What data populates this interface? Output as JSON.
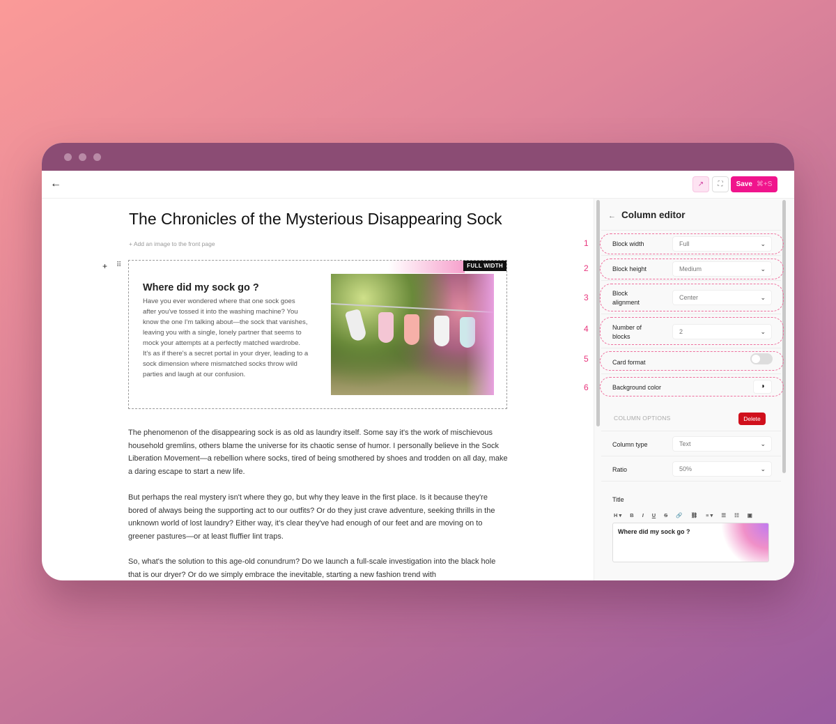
{
  "toolbar": {
    "save_label": "Save",
    "save_shortcut": "⌘+S"
  },
  "article": {
    "title": "The Chronicles of the Mysterious Disappearing Sock",
    "add_image": "+ Add an image to the front page",
    "block": {
      "badge": "FULL WIDTH",
      "heading": "Where did my sock go ?",
      "text": "Have you ever wondered where that one sock goes after you've tossed it into the washing machine? You know the one I'm talking about—the sock that vanishes, leaving you with a single, lonely partner that seems to mock your attempts at a perfectly matched wardrobe. It's as if there's a secret portal in your dryer, leading to a sock dimension where mismatched socks throw wild parties and laugh at our confusion."
    },
    "paragraphs": [
      "The phenomenon of the disappearing sock is as old as laundry itself. Some say it's the work of mischievous household gremlins, others blame the universe for its chaotic sense of humor. I personally believe in the Sock Liberation Movement—a rebellion where socks, tired of being smothered by shoes and trodden on all day, make a daring escape to start a new life.",
      "But perhaps the real mystery isn't where they go, but why they leave in the first place. Is it because they're bored of always being the supporting act to our outfits? Or do they just crave adventure, seeking thrills in the unknown world of lost laundry? Either way, it's clear they've had enough of our feet and are moving on to greener pastures—or at least fluffier lint traps.",
      "So, what's the solution to this age-old conundrum? Do we launch a full-scale investigation into the black hole that is our dryer? Or do we simply embrace the inevitable, starting a new fashion trend with"
    ]
  },
  "panel": {
    "title": "Column editor",
    "rows": [
      {
        "num": "1",
        "label": "Block width",
        "value": "Full"
      },
      {
        "num": "2",
        "label": "Block height",
        "value": "Medium"
      },
      {
        "num": "3",
        "label": "Block alignment",
        "value": "Center"
      },
      {
        "num": "4",
        "label": "Number of blocks",
        "value": "2"
      },
      {
        "num": "5",
        "label": "Card format",
        "toggle": false
      },
      {
        "num": "6",
        "label": "Background color"
      }
    ],
    "column_options": "COLUMN OPTIONS",
    "delete_label": "Delete",
    "column_type": {
      "label": "Column type",
      "value": "Text"
    },
    "ratio": {
      "label": "Ratio",
      "value": "50%"
    },
    "title_label": "Title",
    "rte_tools": [
      "H ▾",
      "B",
      "I",
      "U",
      "S",
      "🔗",
      "⛓",
      "≡ ▾",
      "☰",
      "☷",
      "▣"
    ],
    "title_value": "Where did my sock go ?"
  },
  "colors": {
    "accent": "#f0148c",
    "delete": "#d0101c",
    "highlight": "#ee6f9d"
  }
}
